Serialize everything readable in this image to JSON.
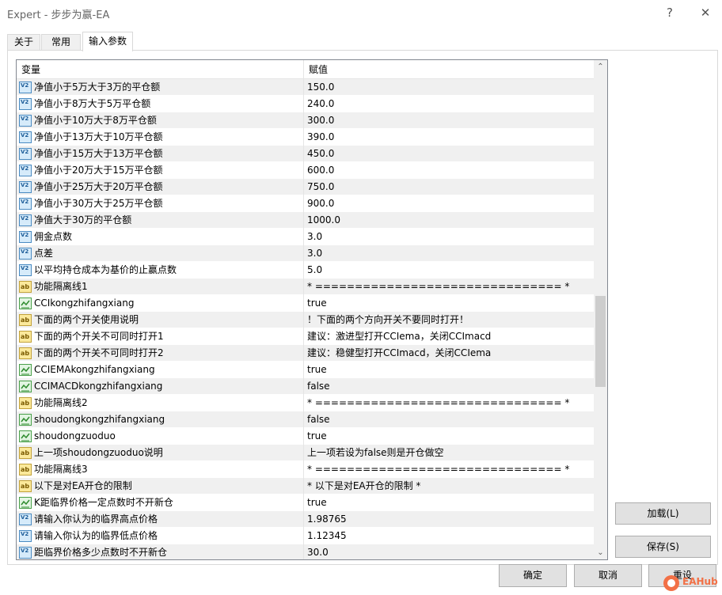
{
  "window": {
    "title": "Expert - 步步为赢-EA",
    "help_glyph": "?",
    "close_glyph": "✕"
  },
  "tabs": [
    {
      "label": "关于"
    },
    {
      "label": "常用"
    },
    {
      "label": "输入参数",
      "active": true
    }
  ],
  "grid": {
    "headers": {
      "variable": "变量",
      "value": "赋值"
    },
    "rows": [
      {
        "type": "v",
        "name": "净值小于5万大于3万的平仓额",
        "value": "150.0"
      },
      {
        "type": "v",
        "name": "净值小于8万大于5万平仓额",
        "value": "240.0"
      },
      {
        "type": "v",
        "name": "净值小于10万大于8万平仓额",
        "value": "300.0"
      },
      {
        "type": "v",
        "name": "净值小于13万大于10万平仓额",
        "value": "390.0"
      },
      {
        "type": "v",
        "name": "净值小于15万大于13万平仓额",
        "value": "450.0"
      },
      {
        "type": "v",
        "name": "净值小于20万大于15万平仓额",
        "value": "600.0"
      },
      {
        "type": "v",
        "name": "净值小于25万大于20万平仓额",
        "value": "750.0"
      },
      {
        "type": "v",
        "name": "净值小于30万大于25万平仓额",
        "value": "900.0"
      },
      {
        "type": "v",
        "name": "净值大于30万的平仓额",
        "value": "1000.0"
      },
      {
        "type": "v",
        "name": "佣金点数",
        "value": "3.0"
      },
      {
        "type": "v",
        "name": "点差",
        "value": "3.0"
      },
      {
        "type": "v",
        "name": "以平均持仓成本为基价的止赢点数",
        "value": "5.0"
      },
      {
        "type": "ab",
        "name": "功能隔离线1",
        "value": "* =============================== *"
      },
      {
        "type": "b",
        "name": "CCIkongzhifangxiang",
        "value": "true"
      },
      {
        "type": "ab",
        "name": "下面的两个开关使用说明",
        "value": "！下面的两个方向开关不要同时打开！"
      },
      {
        "type": "ab",
        "name": "下面的两个开关不可同时打开1",
        "value": "建议：激进型打开CCIema，关闭CCImacd"
      },
      {
        "type": "ab",
        "name": "下面的两个开关不可同时打开2",
        "value": "建议：稳健型打开CCImacd，关闭CCIema"
      },
      {
        "type": "b",
        "name": "CCIEMAkongzhifangxiang",
        "value": "true"
      },
      {
        "type": "b",
        "name": "CCIMACDkongzhifangxiang",
        "value": "false"
      },
      {
        "type": "ab",
        "name": "功能隔离线2",
        "value": "* =============================== *"
      },
      {
        "type": "b",
        "name": "shoudongkongzhifangxiang",
        "value": "false"
      },
      {
        "type": "b",
        "name": "shoudongzuoduo",
        "value": "true"
      },
      {
        "type": "ab",
        "name": "上一项shoudongzuoduo说明",
        "value": "上一项若设为false则是开仓做空"
      },
      {
        "type": "ab",
        "name": "功能隔离线3",
        "value": "* =============================== *"
      },
      {
        "type": "ab",
        "name": "以下是对EA开仓的限制",
        "value": "* 以下是对EA开仓的限制 *"
      },
      {
        "type": "b",
        "name": "K距临界价格一定点数时不开新仓",
        "value": "true"
      },
      {
        "type": "v",
        "name": "请输入你认为的临界高点价格",
        "value": "1.98765"
      },
      {
        "type": "v",
        "name": "请输入你认为的临界低点价格",
        "value": "1.12345"
      },
      {
        "type": "v",
        "name": "距临界价格多少点数时不开新仓",
        "value": "30.0"
      }
    ],
    "scroll_up_glyph": "⌃",
    "scroll_down_glyph": "⌄"
  },
  "buttons": {
    "load": "加载(L)",
    "save": "保存(S)",
    "ok": "确定",
    "cancel": "取消",
    "reset": "重设"
  },
  "watermark": {
    "text": "EAHub"
  },
  "icon_glyphs": {
    "v": "V2",
    "ab": "ab"
  }
}
